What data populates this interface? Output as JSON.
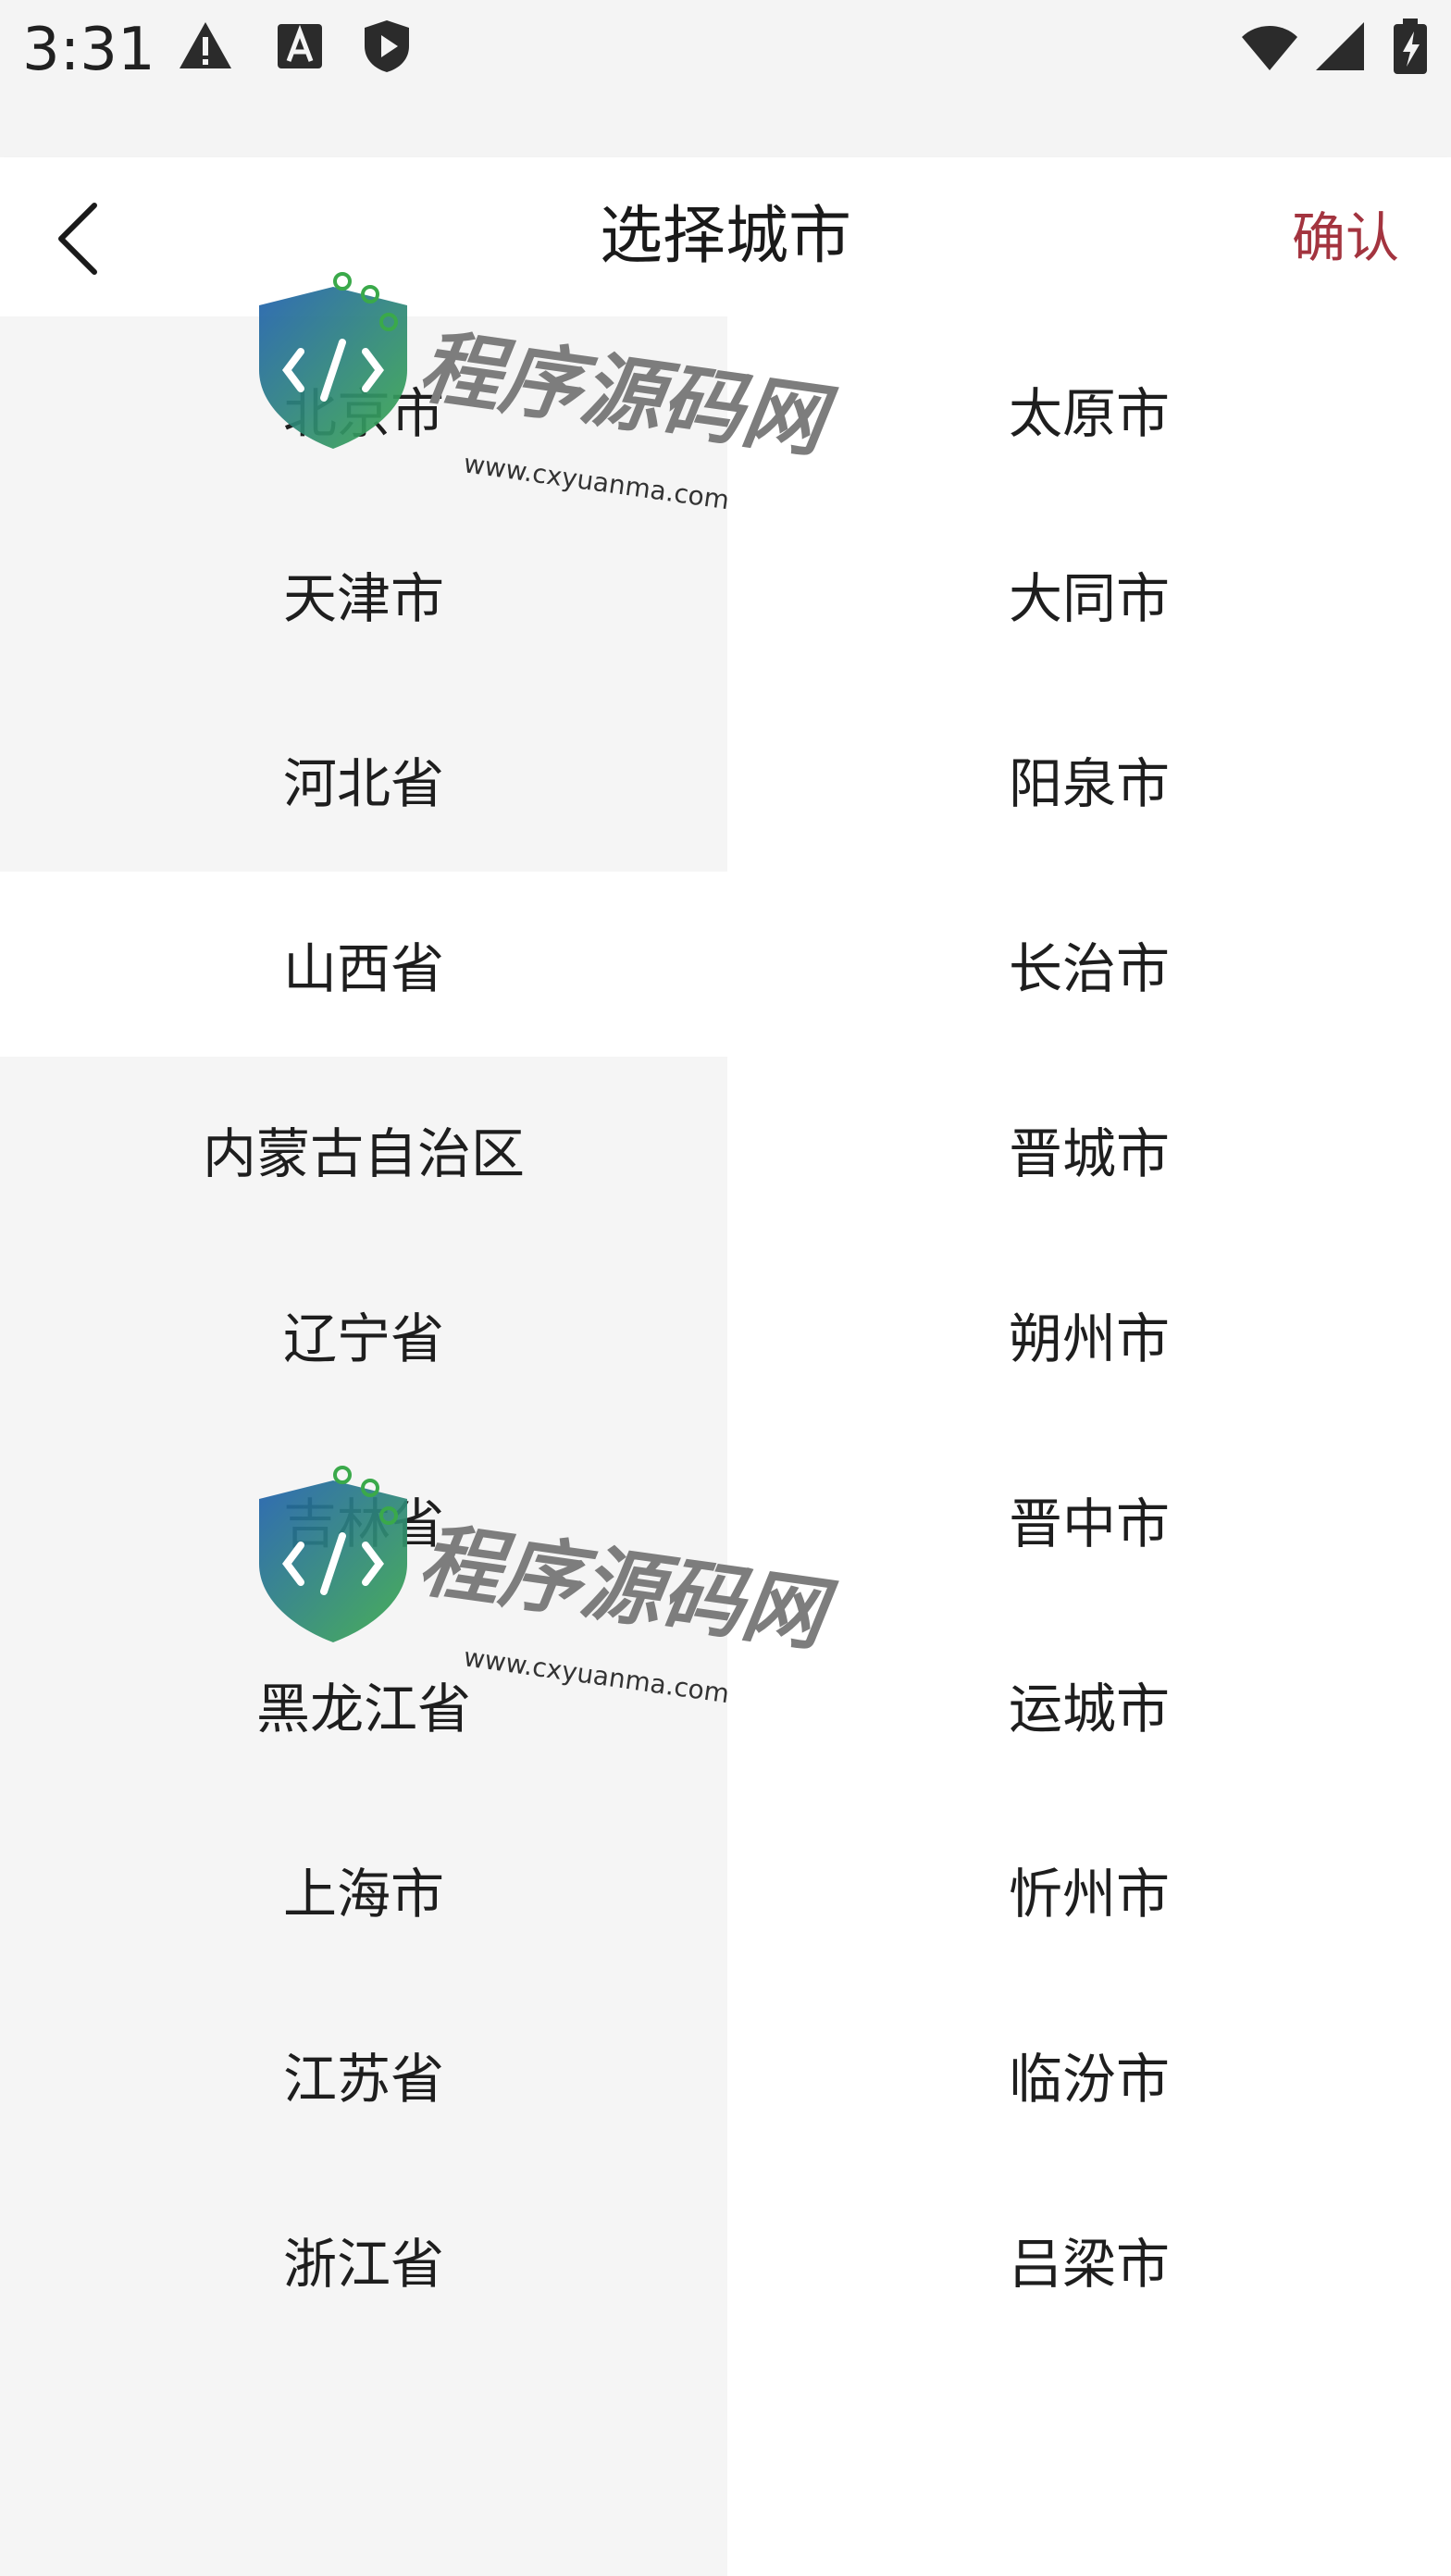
{
  "status_bar": {
    "time": "3:31",
    "left_icons": [
      "warning-icon",
      "font-a-icon",
      "shield-play-icon"
    ],
    "right_icons": [
      "wifi-icon",
      "cellular-signal-icon",
      "battery-charging-icon"
    ]
  },
  "header": {
    "title": "选择城市",
    "confirm_label": "确认",
    "back_icon": "chevron-left-icon"
  },
  "provinces": [
    "北京市",
    "天津市",
    "河北省",
    "山西省",
    "内蒙古自治区",
    "辽宁省",
    "吉林省",
    "黑龙江省",
    "上海市",
    "江苏省",
    "浙江省"
  ],
  "selected_province_index": 3,
  "cities": [
    "太原市",
    "大同市",
    "阳泉市",
    "长治市",
    "晋城市",
    "朔州市",
    "晋中市",
    "运城市",
    "忻州市",
    "临汾市",
    "吕梁市"
  ],
  "watermark": {
    "title": "程序源码网",
    "url": "www.cxyuanma.com"
  },
  "colors": {
    "accent": "#a3343f",
    "left_panel_bg": "#f5f5f5",
    "selected_bg": "#ffffff",
    "watermark_blue": "#1f5fae",
    "watermark_green": "#3aa94a"
  }
}
